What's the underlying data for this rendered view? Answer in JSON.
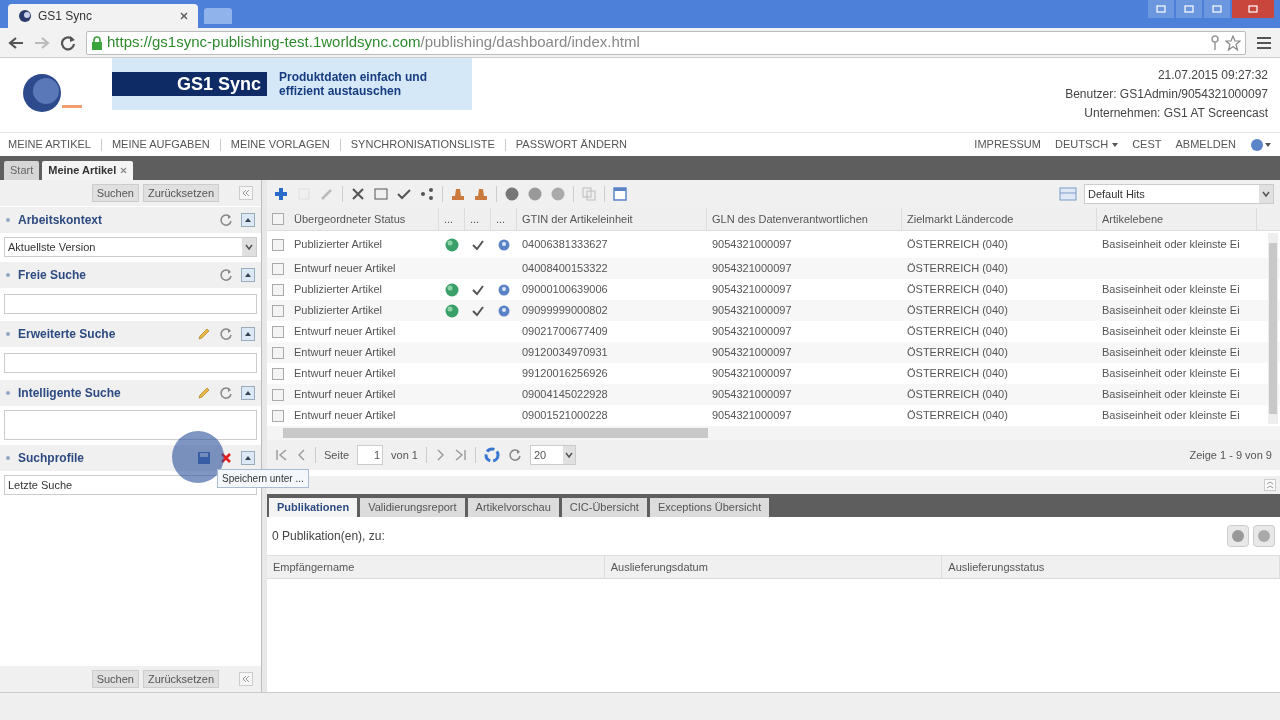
{
  "browser": {
    "tab_title": "GS1 Sync",
    "url_host": "https://gs1sync-publishing-test.1worldsync.com",
    "url_path": "/publishing/dashboard/index.html"
  },
  "header": {
    "banner_title": "GS1 Sync",
    "banner_slogan": "Produktdaten einfach und effizient austauschen",
    "datetime": "21.07.2015 09:27:32",
    "user": "Benutzer: GS1Admin/9054321000097",
    "company": "Unternehmen: GS1 AT Screencast"
  },
  "nav_left": [
    "MEINE ARTIKEL",
    "MEINE AUFGABEN",
    "MEINE VORLAGEN",
    "SYNCHRONISATIONSLISTE",
    "PASSWORT ÄNDERN"
  ],
  "nav_right": [
    {
      "label": "IMPRESSUM",
      "kind": "link"
    },
    {
      "label": "DEUTSCH",
      "kind": "dropdown"
    },
    {
      "label": "CEST",
      "kind": "link"
    },
    {
      "label": "ABMELDEN",
      "kind": "link"
    },
    {
      "kind": "help"
    }
  ],
  "page_tabs": [
    {
      "label": "Start",
      "selected": false,
      "closable": false
    },
    {
      "label": "Meine Artikel",
      "selected": true,
      "closable": true
    }
  ],
  "sidebar": {
    "top_buttons": [
      "Suchen",
      "Zurücksetzen"
    ],
    "sections": [
      {
        "title": "Arbeitskontext",
        "actions": [
          {
            "kind": "reset"
          }
        ],
        "field": {
          "kind": "select",
          "value": "Aktuellste Version"
        }
      },
      {
        "title": "Freie Suche",
        "actions": [
          {
            "kind": "reset"
          }
        ],
        "field": {
          "kind": "input"
        }
      },
      {
        "title": "Erweiterte Suche",
        "actions": [
          {
            "kind": "edit"
          },
          {
            "kind": "reset"
          }
        ],
        "field": {
          "kind": "input"
        }
      },
      {
        "title": "Intelligente Suche",
        "actions": [
          {
            "kind": "edit"
          },
          {
            "kind": "reset"
          }
        ],
        "field": {
          "kind": "textarea"
        }
      },
      {
        "title": "Suchprofile",
        "actions": [
          {
            "kind": "save"
          },
          {
            "kind": "delete"
          }
        ],
        "field": {
          "kind": "select",
          "value": "Letzte Suche"
        }
      }
    ],
    "tooltip": "Speichern unter ...",
    "bottom_buttons": [
      "Suchen",
      "Zurücksetzen"
    ]
  },
  "grid": {
    "view": "Default Hits",
    "all_checked": false,
    "columns": [
      "Übergeordneter Status",
      "...",
      "...",
      "...",
      "GTIN der Artikeleinheit",
      "GLN des Datenverantwortlichen",
      "Zielmarkt Ländercode",
      "Artikelebene"
    ],
    "rows": [
      {
        "checked": false,
        "status": "Publizierter Artikel",
        "published": true,
        "gtin": "04006381333627",
        "gln": "9054321000097",
        "market": "ÖSTERREICH (040)",
        "level_text": "Basiseinheit oder kleinste Ei"
      },
      {
        "checked": false,
        "status": "Entwurf neuer Artikel",
        "published": false,
        "gtin": "04008400153322",
        "gln": "9054321000097",
        "market": "ÖSTERREICH (040)"
      },
      {
        "checked": false,
        "status": "Publizierter Artikel",
        "published": true,
        "gtin": "09000100639006",
        "gln": "9054321000097",
        "market": "ÖSTERREICH (040)",
        "level_text": "Basiseinheit oder kleinste Ei"
      },
      {
        "checked": false,
        "status": "Publizierter Artikel",
        "published": true,
        "gtin": "09099999000802",
        "gln": "9054321000097",
        "market": "ÖSTERREICH (040)",
        "level_text": "Basiseinheit oder kleinste Ei"
      },
      {
        "checked": false,
        "status": "Entwurf neuer Artikel",
        "published": false,
        "gtin": "09021700677409",
        "gln": "9054321000097",
        "market": "ÖSTERREICH (040)",
        "level_text": "Basiseinheit oder kleinste Ei"
      },
      {
        "checked": false,
        "status": "Entwurf neuer Artikel",
        "published": false,
        "gtin": "09120034970931",
        "gln": "9054321000097",
        "market": "ÖSTERREICH (040)",
        "level_text": "Basiseinheit oder kleinste Ei"
      },
      {
        "checked": false,
        "status": "Entwurf neuer Artikel",
        "published": false,
        "gtin": "99120016256926",
        "gln": "9054321000097",
        "market": "ÖSTERREICH (040)",
        "level_text": "Basiseinheit oder kleinste Ei"
      },
      {
        "checked": false,
        "status": "Entwurf neuer Artikel",
        "published": false,
        "gtin": "09004145022928",
        "gln": "9054321000097",
        "market": "ÖSTERREICH (040)",
        "level_text": "Basiseinheit oder kleinste Ei"
      },
      {
        "checked": false,
        "status": "Entwurf neuer Artikel",
        "published": false,
        "gtin": "09001521000228",
        "gln": "9054321000097",
        "market": "ÖSTERREICH (040)",
        "level_text": "Basiseinheit oder kleinste Ei"
      }
    ],
    "pager": {
      "page_label": "Seite",
      "page": "1",
      "of": "von 1",
      "page_size": "20",
      "summary": "Zeige 1 - 9 von 9"
    }
  },
  "details": {
    "tabs": [
      {
        "label": "Publikationen",
        "selected": true
      },
      {
        "label": "Validierungsreport",
        "selected": false
      },
      {
        "label": "Artikelvorschau",
        "selected": false
      },
      {
        "label": "CIC-Übersicht",
        "selected": false
      },
      {
        "label": "Exceptions Übersicht",
        "selected": false
      }
    ],
    "count": "0 Publikation(en), zu:",
    "columns": [
      "Empfängername",
      "Auslieferungsdatum",
      "Auslieferungsstatus"
    ]
  }
}
